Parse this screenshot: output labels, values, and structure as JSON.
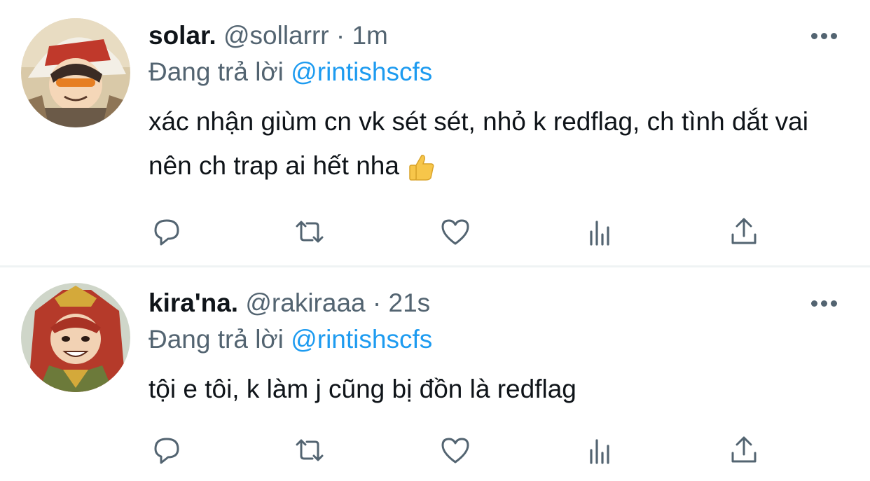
{
  "tweets": [
    {
      "display_name": "solar.",
      "handle": "@sollarrr",
      "separator": "·",
      "time": "1m",
      "reply_prefix": "Đang trả lời",
      "reply_to": "@rintishscfs",
      "text": "xác nhận giùm cn vk sét sét, nhỏ k redflag, ch tình dắt vai nên ch trap ai hết nha",
      "emoji_icon": "thumbs-up-icon"
    },
    {
      "display_name": "kira'na.",
      "handle": "@rakiraaa",
      "separator": "·",
      "time": "21s",
      "reply_prefix": "Đang trả lời",
      "reply_to": "@rintishscfs",
      "text": "tội e tôi, k làm j cũng bị đồn là redflag"
    }
  ],
  "actions": [
    "reply-icon",
    "retweet-icon",
    "like-icon",
    "views-icon",
    "share-icon"
  ],
  "colors": {
    "text": "#0f1419",
    "muted": "#536471",
    "link": "#1d9bf0",
    "divider": "#eff3f4"
  }
}
